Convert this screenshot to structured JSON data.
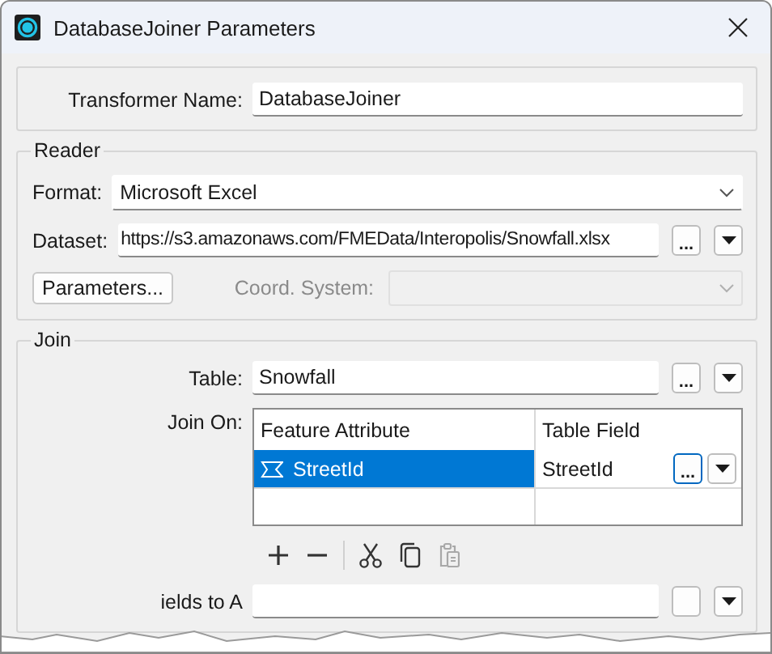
{
  "window": {
    "title": "DatabaseJoiner Parameters"
  },
  "transformer_name": {
    "label": "Transformer Name:",
    "value": "DatabaseJoiner"
  },
  "reader": {
    "title": "Reader",
    "format": {
      "label": "Format:",
      "value": "Microsoft Excel"
    },
    "dataset": {
      "label": "Dataset:",
      "value": "https://s3.amazonaws.com/FMEData/Interopolis/Snowfall.xlsx",
      "browse": "..."
    },
    "parameters_button": "Parameters...",
    "coord_system": {
      "label": "Coord. System:",
      "disabled": true
    }
  },
  "join": {
    "title": "Join",
    "table": {
      "label": "Table:",
      "value": "Snowfall",
      "browse": "..."
    },
    "join_on": {
      "label": "Join On:",
      "columns": [
        "Feature Attribute",
        "Table Field"
      ],
      "rows": [
        {
          "feature_attribute": "StreetId",
          "table_field": "StreetId",
          "selected": true,
          "browse": "..."
        }
      ]
    },
    "toolbar": [
      {
        "kind": "add",
        "disabled": false
      },
      {
        "kind": "remove",
        "disabled": false
      },
      {
        "kind": "cut",
        "disabled": false
      },
      {
        "kind": "copy",
        "disabled": false
      },
      {
        "kind": "paste",
        "disabled": true
      }
    ],
    "fields_row": {
      "label": "ields to A"
    }
  }
}
